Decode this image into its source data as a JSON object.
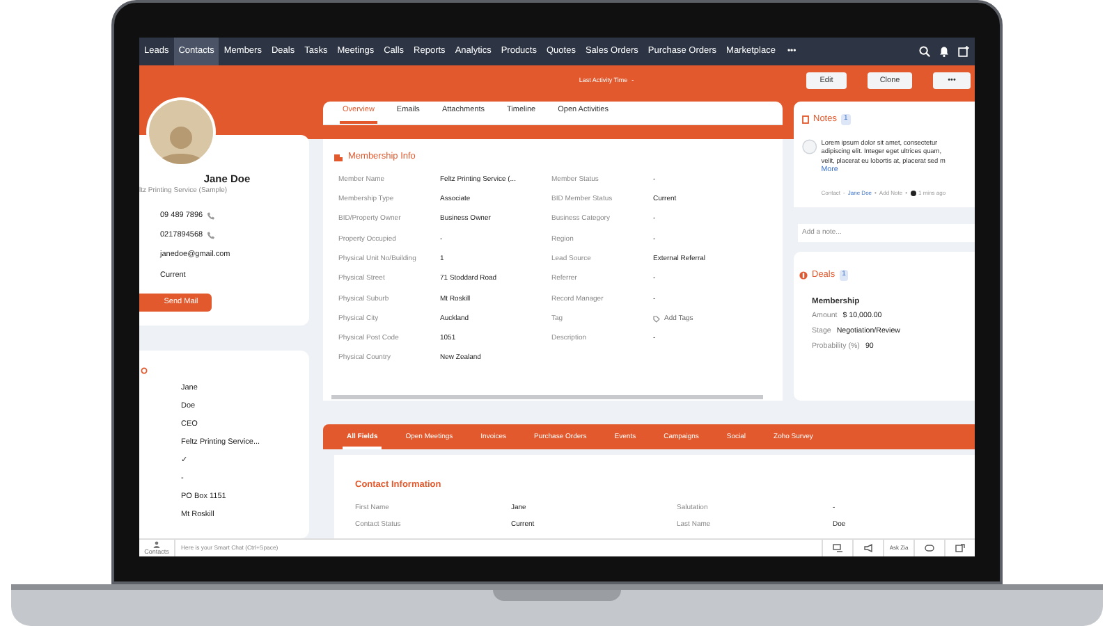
{
  "nav": {
    "items": [
      {
        "label": "Leads",
        "selected": false
      },
      {
        "label": "Contacts",
        "selected": true
      },
      {
        "label": "Members",
        "selected": false
      },
      {
        "label": "Deals",
        "selected": false
      },
      {
        "label": "Tasks",
        "selected": false
      },
      {
        "label": "Meetings",
        "selected": false
      },
      {
        "label": "Calls",
        "selected": false
      },
      {
        "label": "Reports",
        "selected": false
      },
      {
        "label": "Analytics",
        "selected": false
      },
      {
        "label": "Products",
        "selected": false
      },
      {
        "label": "Quotes",
        "selected": false
      },
      {
        "label": "Sales Orders",
        "selected": false
      },
      {
        "label": "Purchase Orders",
        "selected": false
      },
      {
        "label": "Marketplace",
        "selected": false
      }
    ],
    "more": "•••"
  },
  "header": {
    "sort_label": "Last Activity Time",
    "sort_value": "-",
    "buttons": [
      "Edit",
      "Clone",
      "•••"
    ]
  },
  "profile": {
    "name": "Jane Doe",
    "company": "ltz Printing Service (Sample)",
    "phones": [
      "09 489 7896",
      "0217894568"
    ],
    "email": "janedoe@gmail.com",
    "status": "Current",
    "button": "Send Mail"
  },
  "side_values": [
    "Jane",
    "Doe",
    "CEO",
    "Feltz Printing Service...",
    "✓",
    "-",
    "PO Box 1151",
    "Mt Roskill"
  ],
  "tabs": [
    {
      "label": "Overview",
      "selected": true
    },
    {
      "label": "Emails",
      "selected": false
    },
    {
      "label": "Attachments",
      "selected": false
    },
    {
      "label": "Timeline",
      "selected": false
    },
    {
      "label": "Open Activities",
      "selected": false
    }
  ],
  "membership": {
    "title": "Membership Info",
    "left": [
      {
        "label": "Member Name",
        "value": "Feltz Printing Service (..."
      },
      {
        "label": "Membership Type",
        "value": "Associate"
      },
      {
        "label": "BID/Property Owner",
        "value": "Business Owner"
      },
      {
        "label": "Property Occupied",
        "value": "-"
      },
      {
        "label": "Physical Unit No/Building",
        "value": "1"
      },
      {
        "label": "Physical Street",
        "value": "71 Stoddard Road"
      },
      {
        "label": "Physical Suburb",
        "value": "Mt Roskill"
      },
      {
        "label": "Physical City",
        "value": "Auckland"
      },
      {
        "label": "Physical Post Code",
        "value": "1051"
      },
      {
        "label": "Physical Country",
        "value": "New Zealand"
      }
    ],
    "right": [
      {
        "label": "Member Status",
        "value": "-"
      },
      {
        "label": "BID Member Status",
        "value": "Current"
      },
      {
        "label": "Business Category",
        "value": "-"
      },
      {
        "label": "Region",
        "value": "-"
      },
      {
        "label": "Lead Source",
        "value": "External Referral"
      },
      {
        "label": "Referrer",
        "value": "-"
      },
      {
        "label": "Record Manager",
        "value": "-"
      },
      {
        "label": "Tag",
        "action": "Add Tags"
      },
      {
        "label": "Description",
        "value": "-"
      }
    ]
  },
  "notes": {
    "title": "Notes",
    "count": "1",
    "text_lines": [
      "Lorem ipsum dolor sit amet, consectetur",
      "adipiscing elit. Integer eget ultrices quam,",
      "velit, placerat eu lobortis at, placerat sed m"
    ],
    "more": "More",
    "meta_kind": "Contact",
    "meta_sep": "-",
    "meta_link": "Jane Doe",
    "meta_bullets": [
      "•",
      "•"
    ],
    "meta_action": "Add Note",
    "meta_time": "1 mins ago",
    "placeholder": "Add a note..."
  },
  "deals": {
    "title": "Deals",
    "count": "1",
    "name": "Membership",
    "fields": [
      {
        "label": "Amount",
        "value": "$ 10,000.00"
      },
      {
        "label": "Stage",
        "value": "Negotiation/Review"
      },
      {
        "label": "Probability (%)",
        "value": "90"
      }
    ]
  },
  "lower_tabs": [
    {
      "label": "All Fields",
      "selected": true
    },
    {
      "label": "Open Meetings",
      "selected": false
    },
    {
      "label": "Invoices",
      "selected": false
    },
    {
      "label": "Purchase Orders",
      "selected": false
    },
    {
      "label": "Events",
      "selected": false
    },
    {
      "label": "Campaigns",
      "selected": false
    },
    {
      "label": "Social",
      "selected": false
    },
    {
      "label": "Zoho Survey",
      "selected": false
    }
  ],
  "contact_info": {
    "title": "Contact Information",
    "fields": [
      {
        "label": "First Name",
        "value": "Jane"
      },
      {
        "label": "Salutation",
        "value": "-"
      },
      {
        "label": "Contact Status",
        "value": "Current"
      },
      {
        "label": "Last Name",
        "value": "Doe"
      }
    ]
  },
  "bottom_bar": {
    "contacts_label": "Contacts",
    "chat_placeholder": "Here is your Smart Chat (Ctrl+Space)",
    "zia": "Ask Zia"
  }
}
